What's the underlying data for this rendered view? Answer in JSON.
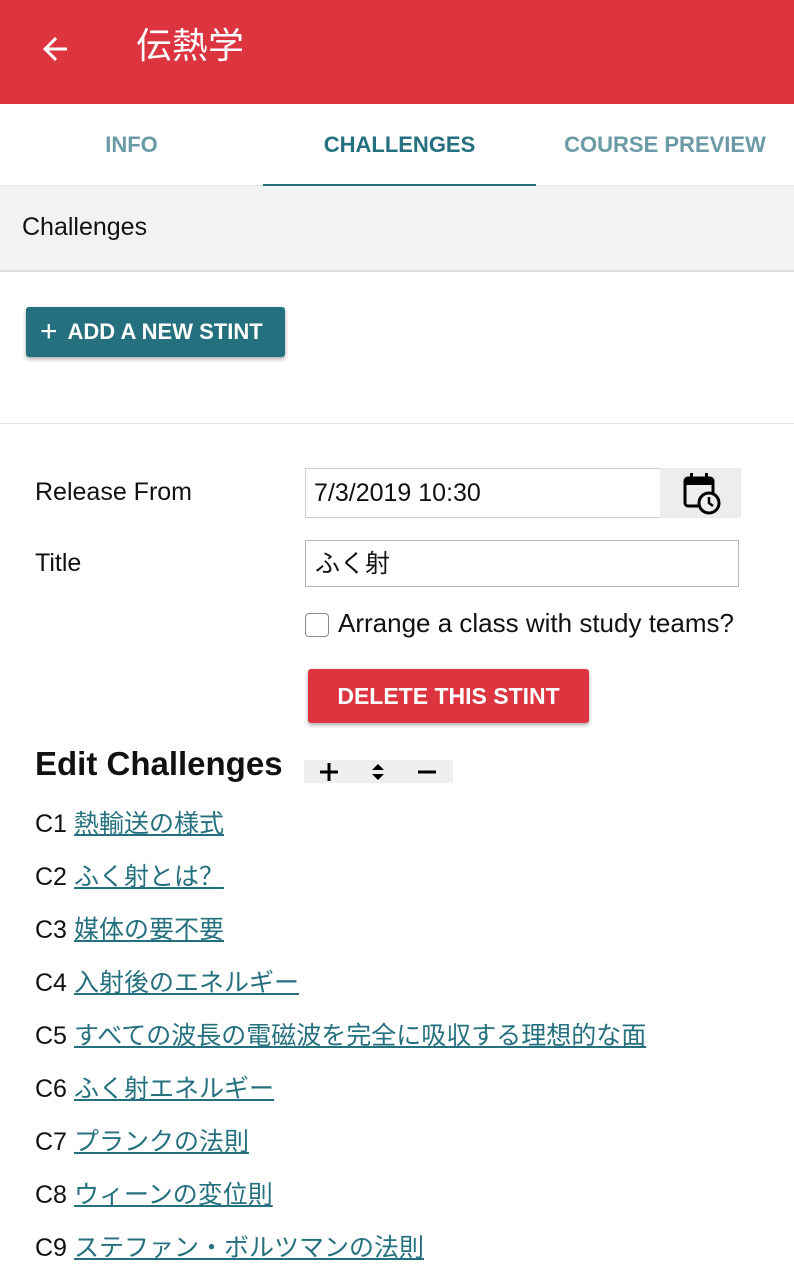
{
  "app_bar": {
    "title": "伝熱学",
    "back_icon": "arrow-left-icon",
    "color": "#dc3540"
  },
  "tabs": [
    {
      "label": "INFO",
      "active": false
    },
    {
      "label": "CHALLENGES",
      "active": true
    },
    {
      "label": "COURSE PREVIEW",
      "active": false
    }
  ],
  "section": {
    "title": "Challenges"
  },
  "actions": {
    "add_stint_label": "ADD A NEW STINT",
    "add_icon": "plus-icon",
    "delete_stint_label": "DELETE THIS STINT"
  },
  "form": {
    "release_label": "Release From",
    "release_value": "7/3/2019 10:30",
    "calendar_icon": "calendar-clock-icon",
    "title_label": "Title",
    "title_value": "ふく射",
    "teams_checkbox_label": "Arrange a class with study teams?",
    "teams_checked": false
  },
  "edit": {
    "heading": "Edit Challenges",
    "tools": [
      "plus-icon",
      "sort-icon",
      "minus-icon"
    ]
  },
  "challenges": [
    {
      "code": "C1",
      "title": "熱輸送の様式"
    },
    {
      "code": "C2",
      "title": "ふく射とは？"
    },
    {
      "code": "C3",
      "title": "媒体の要不要"
    },
    {
      "code": "C4",
      "title": "入射後のエネルギー"
    },
    {
      "code": "C5",
      "title": "すべての波長の電磁波を完全に吸収する理想的な面"
    },
    {
      "code": "C6",
      "title": "ふく射エネルギー"
    },
    {
      "code": "C7",
      "title": "プランクの法則"
    },
    {
      "code": "C8",
      "title": "ウィーンの変位則"
    },
    {
      "code": "C9",
      "title": "ステファン・ボルツマンの法則"
    }
  ],
  "colors": {
    "primary": "#25707f",
    "danger": "#dc3540"
  }
}
